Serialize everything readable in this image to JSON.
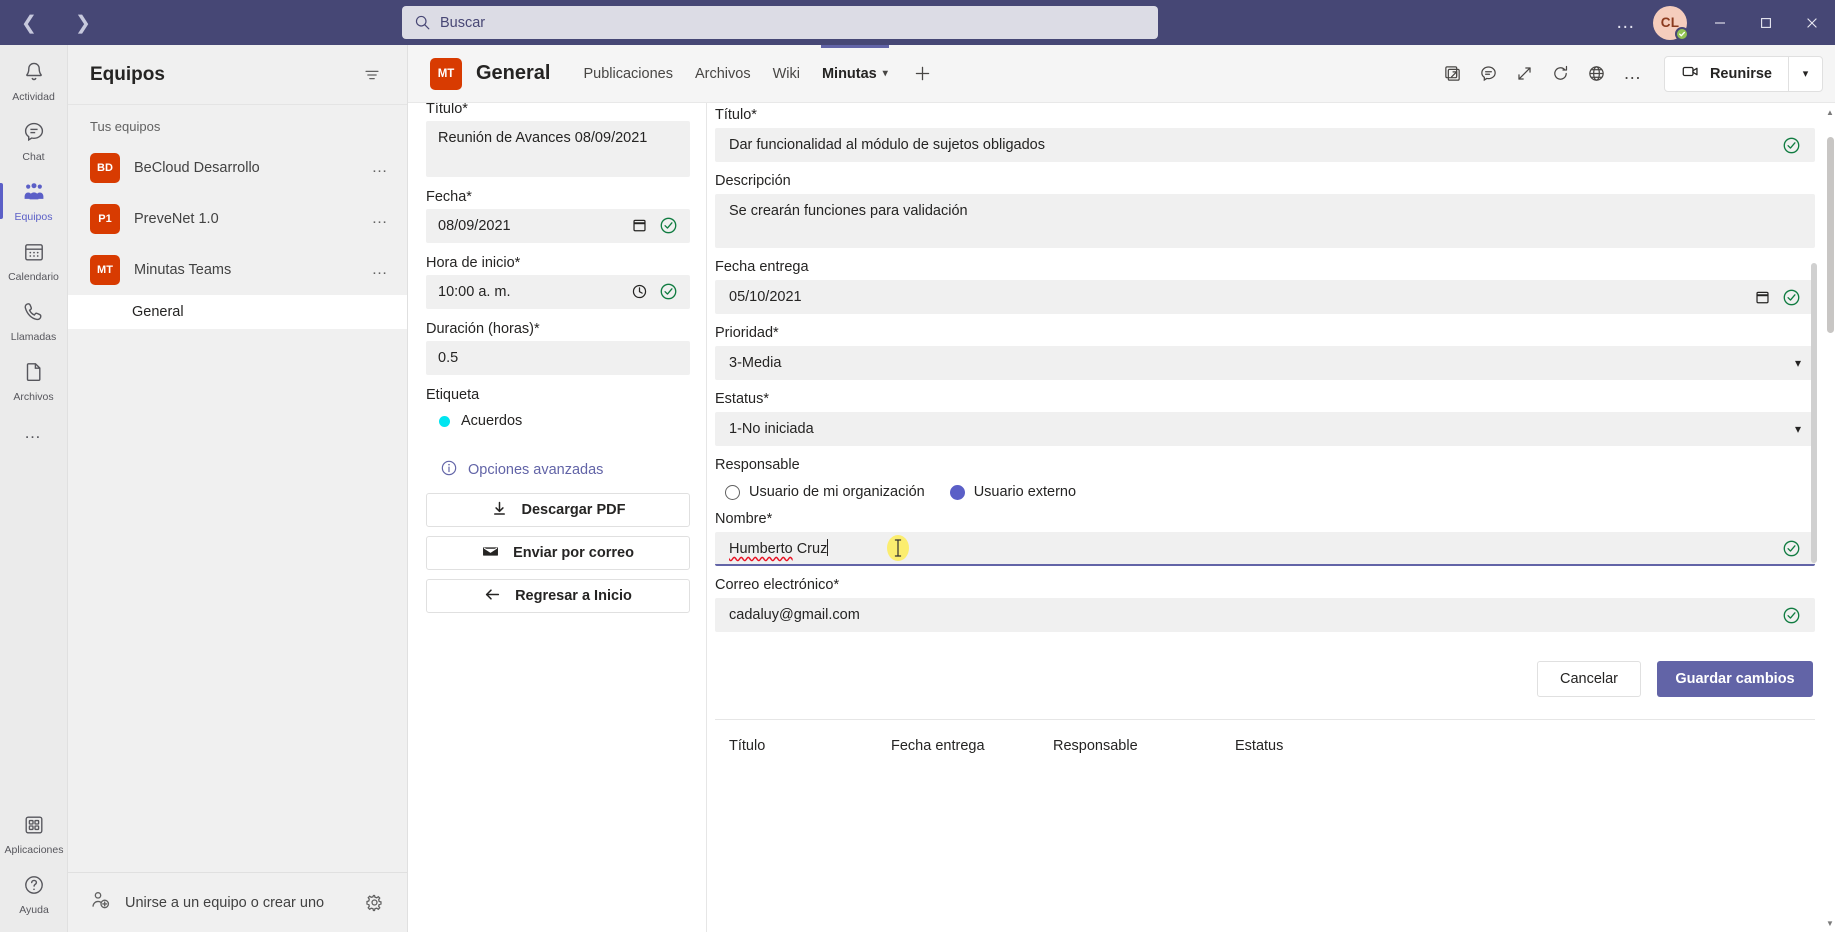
{
  "titlebar": {
    "back_tooltip": "Atrás",
    "forward_tooltip": "Adelante",
    "search_placeholder": "Buscar",
    "more_label": "…",
    "avatar_initials": "CL",
    "minimize_label": "Minimizar",
    "maximize_label": "Maximizar",
    "close_label": "Cerrar"
  },
  "rail": {
    "items": [
      {
        "label": "Actividad",
        "icon": "bell-icon",
        "active": false
      },
      {
        "label": "Chat",
        "icon": "chat-icon",
        "active": false
      },
      {
        "label": "Equipos",
        "icon": "teams-icon",
        "active": true
      },
      {
        "label": "Calendario",
        "icon": "calendar-icon",
        "active": false
      },
      {
        "label": "Llamadas",
        "icon": "phone-icon",
        "active": false
      },
      {
        "label": "Archivos",
        "icon": "file-icon",
        "active": false
      }
    ],
    "more_label": "…",
    "bottom": [
      {
        "label": "Aplicaciones",
        "icon": "apps-icon"
      },
      {
        "label": "Ayuda",
        "icon": "help-icon"
      }
    ]
  },
  "teams_panel": {
    "title": "Equipos",
    "filter_label": "Filtrar",
    "section_label": "Tus equipos",
    "teams": [
      {
        "initials": "BD",
        "name": "BeCloud Desarrollo",
        "more": "…",
        "color": "#d83b01"
      },
      {
        "initials": "P1",
        "name": "PreveNet 1.0",
        "more": "…",
        "color": "#d83b01"
      },
      {
        "initials": "MT",
        "name": "Minutas Teams",
        "more": "…",
        "color": "#d83b01"
      }
    ],
    "channels": [
      {
        "name": "General",
        "active": true
      }
    ],
    "footer_label": "Unirse a un equipo o crear uno",
    "settings_label": "Administrar configuración de equipos"
  },
  "channel_header": {
    "avatar_initials": "MT",
    "title": "General",
    "tabs": [
      {
        "label": "Publicaciones",
        "active": false,
        "has_chevron": false
      },
      {
        "label": "Archivos",
        "active": false,
        "has_chevron": false
      },
      {
        "label": "Wiki",
        "active": false,
        "has_chevron": false
      },
      {
        "label": "Minutas",
        "active": true,
        "has_chevron": true
      }
    ],
    "add_tab_label": "+",
    "actions": [
      {
        "name": "open-in-new-window-icon"
      },
      {
        "name": "conversation-icon"
      },
      {
        "name": "expand-icon"
      },
      {
        "name": "refresh-icon"
      },
      {
        "name": "globe-icon"
      },
      {
        "name": "more-options-icon",
        "label": "…"
      }
    ],
    "meet_label": "Reunirse",
    "meet_dropdown_label": "Opciones de reunión"
  },
  "left_form": {
    "title_label": "Título*",
    "title_value": "Reunión  de Avances 08/09/2021",
    "date_label": "Fecha*",
    "date_value": "08/09/2021",
    "time_label": "Hora de inicio*",
    "time_value": "10:00  a. m.",
    "duration_label": "Duración (horas)*",
    "duration_value": "0.5",
    "tag_label": "Etiqueta",
    "tag_value": "Acuerdos",
    "tag_color": "#00e5f0",
    "advanced_label": "Opciones avanzadas",
    "advanced_color": "#6264a7",
    "buttons": [
      {
        "label": "Descargar PDF",
        "icon": "download-icon"
      },
      {
        "label": "Enviar por correo",
        "icon": "mail-icon"
      },
      {
        "label": "Regresar a Inicio",
        "icon": "arrow-left-icon"
      }
    ]
  },
  "right_form": {
    "title_label": "Título*",
    "title_value": "Dar funcionalidad al módulo de sujetos obligados",
    "description_label": "Descripción",
    "description_value": "Se crearán funciones para validación",
    "due_date_label": "Fecha entrega",
    "due_date_value": "05/10/2021",
    "priority_label": "Prioridad*",
    "priority_value": "3-Media",
    "status_label": "Estatus*",
    "status_value": "1-No iniciada",
    "responsible_label": "Responsable",
    "radio_internal_label": "Usuario de mi organización",
    "radio_external_label": "Usuario externo",
    "radio_selected": "externo",
    "name_label": "Nombre*",
    "name_value_misspelled": "Humberto",
    "name_value_rest": " Cruz",
    "email_label": "Correo electrónico*",
    "email_value": "cadaluy@gmail.com",
    "cancel_label": "Cancelar",
    "save_label": "Guardar cambios",
    "accent_color": "#6264a7"
  },
  "task_table": {
    "columns": [
      "Título",
      "Fecha entrega",
      "Responsable",
      "Estatus"
    ]
  }
}
